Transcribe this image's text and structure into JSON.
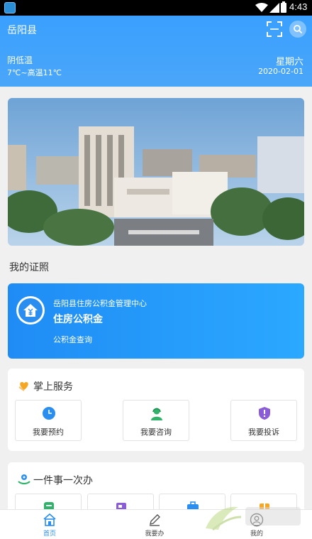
{
  "status_bar": {
    "time": "4:43"
  },
  "header": {
    "county": "岳阳县",
    "weather": "阴低温",
    "temperature": "7℃~高温11℃",
    "weekday": "星期六",
    "date": "2020-02-01"
  },
  "licenses": {
    "section_title": "我的证照",
    "card": {
      "org": "岳阳县住房公积金管理中心",
      "name": "住房公积金",
      "action": "公积金查询"
    }
  },
  "services": {
    "title": "掌上服务",
    "items": [
      {
        "label": "我要预约",
        "icon": "clock-icon"
      },
      {
        "label": "我要咨询",
        "icon": "consultant-icon"
      },
      {
        "label": "我要投诉",
        "icon": "complaint-shield-icon"
      }
    ]
  },
  "one_thing": {
    "title": "一件事一次办"
  },
  "bottom_nav": {
    "items": [
      {
        "label": "首页",
        "icon": "home-icon",
        "active": true
      },
      {
        "label": "我要办",
        "icon": "pen-icon",
        "active": false
      },
      {
        "label": "我的",
        "icon": "user-icon",
        "active": false
      }
    ]
  },
  "colors": {
    "primary": "#2a8ef0",
    "header": "#3aa0ff",
    "accent_orange": "#f5a623"
  }
}
